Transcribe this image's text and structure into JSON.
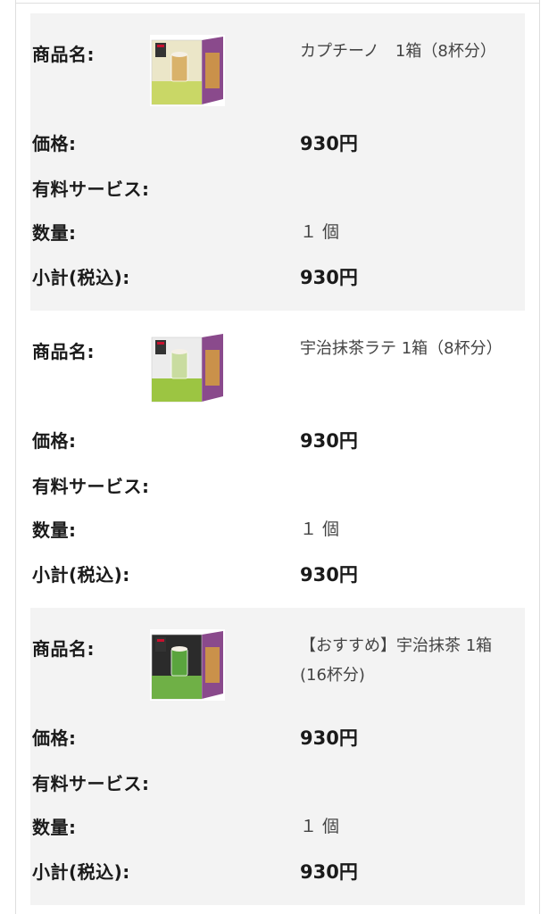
{
  "labels": {
    "name": "商品名:",
    "price": "価格:",
    "paid_service": "有料サービス:",
    "quantity": "数量:",
    "subtotal": "小計(税込):"
  },
  "items": [
    {
      "name": "カプチーノ　1箱（8杯分）",
      "price": "930円",
      "paid_service": "",
      "quantity": "１ 個",
      "subtotal": "930円",
      "image_icon": "cappuccino-box-image",
      "box_colors": {
        "front": "#ebe6c8",
        "band": "#c9d766",
        "cup": "#d9b26a",
        "side": "#8a4a8c"
      }
    },
    {
      "name": "宇治抹茶ラテ 1箱（8杯分）",
      "price": "930円",
      "paid_service": "",
      "quantity": "１ 個",
      "subtotal": "930円",
      "image_icon": "matcha-latte-box-image",
      "box_colors": {
        "front": "#ececec",
        "band": "#9cc542",
        "cup": "#c9dca0",
        "side": "#8a4a8c"
      }
    },
    {
      "name": "【おすすめ】宇治抹茶 1箱(16杯分)",
      "price": "930円",
      "paid_service": "",
      "quantity": "１ 個",
      "subtotal": "930円",
      "image_icon": "uji-matcha-box-image",
      "box_colors": {
        "front": "#2b2b2b",
        "band": "#6fb046",
        "cup": "#5aa43e",
        "side": "#8a4a8c"
      }
    }
  ]
}
